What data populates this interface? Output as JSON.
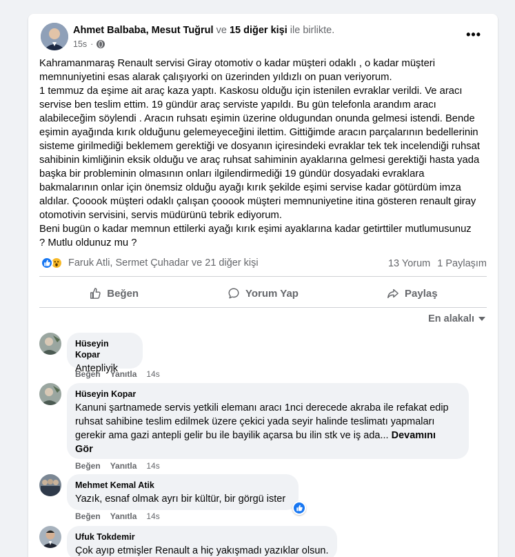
{
  "post": {
    "author_primary": "Ahmet Balbaba",
    "author_sep": ", ",
    "author_secondary": "Mesut Tuğrul",
    "with_ve": " ve ",
    "others": "15 diğer kişi",
    "with_tail": " ile birlikte.",
    "time": "15s",
    "more_menu": "•••",
    "text": "Kahramanmaraş Renault servisi Giray otomotiv o kadar müşteri odaklı , o kadar müşteri\nmemnuniyetini esas alarak çalışıyorki on üzerinden yıldızlı on puan veriyorum.\n1 temmuz da eşime ait araç kaza yaptı. Kaskosu olduğu için istenilen evraklar verildi. Ve aracı\nservise ben teslim ettim. 19 gündür araç serviste yapıldı. Bu gün telefonla arandım aracı\nalabileceğim söylendi . Aracın ruhsatı eşimin üzerine oldugundan onunda gelmesi istendi. Bende\neşimin ayağında kırık olduğunu gelemeyeceğini ilettim. Gittiğimde aracın parçalarının bedellerinin\nsisteme girilmediği beklemem gerektiği ve dosyanın içiresindeki evraklar tek tek incelendiği ruhsat\nsahibinin kimliğinin eksik olduğu ve araç ruhsat sahiminin ayaklarına gelmesi gerektiği hasta yada\nbaşka bir probleminin olmasının onları ilgilendirmediği 19 gündür dosyadaki evraklara\nbakmalarının onlar için önemsiz olduğu ayağı kırık şekilde eşimi servise kadar götürdüm imza\naldılar. Çooook müşteri odaklı çalışan çooook müşteri memnuniyetine itina gösteren renault giray\notomotivin servisini, servis müdürünü tebrik ediyorum.\nBeni bugün o kadar memnun ettilerki ayağı kırık eşimi ayaklarına kadar getirttiler  mutlumusunuz\n? Mutlu oldunuz mu ?",
    "reactors": "Faruk Atli, Sermet Çuhadar ve 21 diğer kişi",
    "comment_count": "13 Yorum",
    "share_count": "1 Paylaşım",
    "actions": {
      "like": "Beğen",
      "comment": "Yorum Yap",
      "share": "Paylaş"
    },
    "sort_label": "En alakalı"
  },
  "comments": [
    {
      "name": "Hüseyin Kopar",
      "text": "Antepliyik",
      "like": "Beğen",
      "reply": "Yanıtla",
      "time": "14s"
    },
    {
      "name": "Hüseyin Kopar",
      "text": "Kanuni şartnamede servis yetkili elemanı aracı 1nci derecede akraba ile refakat edip\nruhsat sahibine teslim edilmek üzere çekici yada seyir halinde teslimatı yapmaları\ngerekir ama gazi antepli gelir bu ile bayilik açarsa bu ilin stk ve iş ada... ",
      "see_more": "Devamını\nGör",
      "like": "Beğen",
      "reply": "Yanıtla",
      "time": "14s"
    },
    {
      "name": "Mehmet Kemal Atik",
      "text": "Yazık, esnaf olmak ayrı bir kültür, bir görgü ister",
      "like": "Beğen",
      "reply": "Yanıtla",
      "time": "14s"
    },
    {
      "name": "Ufuk Tokdemir",
      "text": "Çok ayıp etmişler Renault a hiç yakışmadı yazıklar olsun."
    }
  ],
  "colors": {
    "accent": "#1877f2",
    "secondary_text": "#65676b",
    "bubble": "#f0f2f5"
  },
  "icons": {
    "like": "thumbs-up-icon",
    "comment": "speech-bubble-icon",
    "share": "share-arrow-icon",
    "globe": "globe-icon",
    "wow": "wow-reaction-icon"
  }
}
